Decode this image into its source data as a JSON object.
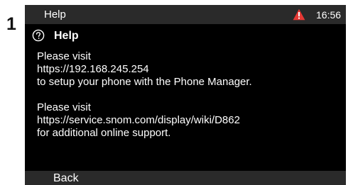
{
  "callout": {
    "number": "1"
  },
  "status_bar": {
    "title": "Help",
    "time": "16:56",
    "warning_icon": "warning-triangle-icon",
    "warning_color": "#e53935"
  },
  "header": {
    "icon": "help-circle-icon",
    "title": "Help"
  },
  "body": {
    "paragraphs": [
      {
        "lines": [
          "Please visit",
          "https://192.168.245.254",
          "to setup your phone with the Phone Manager."
        ]
      },
      {
        "lines": [
          "Please visit",
          "https://service.snom.com/display/wiki/D862",
          "for additional online support."
        ]
      }
    ]
  },
  "softkeys": {
    "back_label": "Back"
  },
  "colors": {
    "screen_background": "#000000",
    "bar_background": "#2a2a2a",
    "text": "#ffffff"
  }
}
